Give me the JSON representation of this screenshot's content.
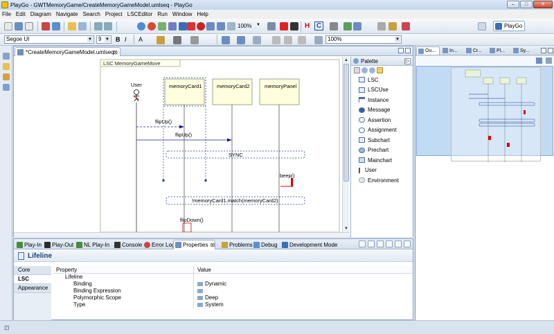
{
  "window": {
    "title": "PlayGo - GWTMemoryGame/CreateMemoryGameModel.umlseq - PlayGo"
  },
  "menu": [
    "File",
    "Edit",
    "Diagram",
    "Navigate",
    "Search",
    "Project",
    "LSCEditor",
    "Run",
    "Window",
    "Help"
  ],
  "toolbar": {
    "zoom": "100%",
    "zoom2": "100%",
    "font_name": "Segoe UI",
    "font_size": "9",
    "h_label": "H",
    "c_label": "C"
  },
  "perspective": {
    "label": "PlayGo"
  },
  "editor_tab": {
    "label": "*CreateMemoryGameModel.umlseq"
  },
  "diagram": {
    "frame_title": "LSC MemoryGameMove",
    "user_label": "User",
    "lifelines": [
      "memoryCard1",
      "memoryCard2",
      "memoryPanel"
    ],
    "messages": [
      "flipUp()",
      "flipUp()",
      "beep()",
      "flipDown()"
    ],
    "sync_label": "SYNC",
    "assertion_label": "!memoryCard1.match(memoryCard2)"
  },
  "palette": {
    "title": "Palette",
    "items": [
      "LSC",
      "LSCUse",
      "Instance",
      "Message",
      "Assertion",
      "Assignment",
      "Subchart",
      "Prechart",
      "Mainchart",
      "User",
      "Environment"
    ]
  },
  "right_tabs": [
    "Ou...",
    "In...",
    "Cr...",
    "Pl...",
    "Sy..."
  ],
  "bottom_tabs": [
    {
      "label": "Play-In",
      "close": ""
    },
    {
      "label": "Play-Out",
      "close": ""
    },
    {
      "label": "NL Play-In",
      "close": ""
    },
    {
      "label": "Console",
      "close": ""
    },
    {
      "label": "Error Log",
      "close": ""
    },
    {
      "label": "Properties",
      "close": "⊠"
    },
    {
      "label": "Problems",
      "close": ""
    },
    {
      "label": "Debug",
      "close": ""
    },
    {
      "label": "Development Mode",
      "close": ""
    }
  ],
  "properties": {
    "title": "Lifeline",
    "side_tabs": [
      "Core",
      "LSC",
      "Appearance"
    ],
    "columns": [
      "Property",
      "Value"
    ],
    "group": "Lifeline",
    "rows": [
      {
        "property": "Binding",
        "value": "Dynamic"
      },
      {
        "property": "Binding Expression",
        "value": ""
      },
      {
        "property": "Polymorphic Scope",
        "value": "Deep"
      },
      {
        "property": "Type",
        "value": "System"
      }
    ]
  },
  "colors": {
    "lifeline_fill": "#ffffdd",
    "message": "#1a1a8c",
    "beep": "#d00000"
  }
}
